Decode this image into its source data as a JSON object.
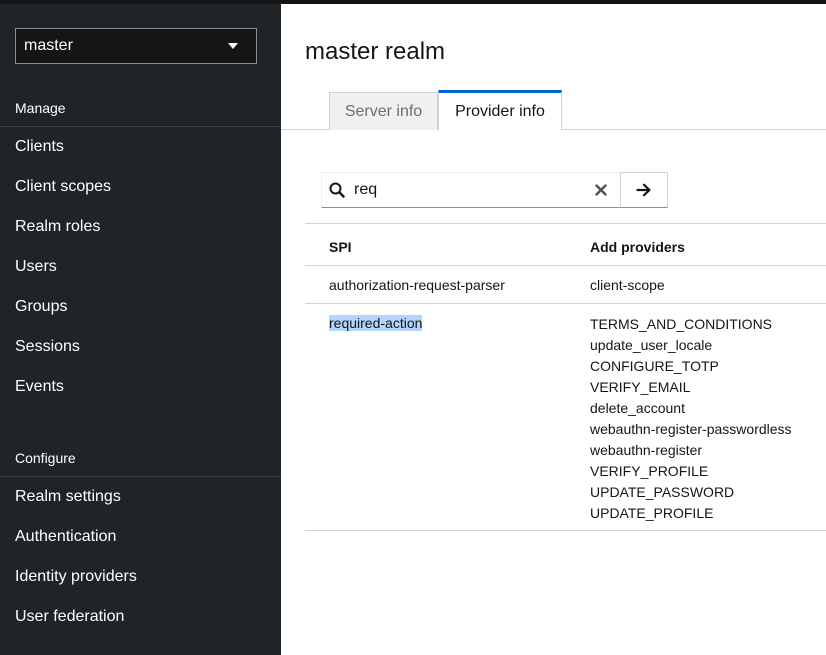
{
  "sidebar": {
    "realm_select": "master",
    "manage_title": "Manage",
    "manage_items": [
      "Clients",
      "Client scopes",
      "Realm roles",
      "Users",
      "Groups",
      "Sessions",
      "Events"
    ],
    "configure_title": "Configure",
    "configure_items": [
      "Realm settings",
      "Authentication",
      "Identity providers",
      "User federation"
    ]
  },
  "main": {
    "title": "master realm",
    "tabs": [
      {
        "label": "Server info",
        "active": false
      },
      {
        "label": "Provider info",
        "active": true
      }
    ],
    "search": {
      "value": "req",
      "icon": "search-icon",
      "clear_icon": "close-icon",
      "go_icon": "arrow-right-icon"
    },
    "table": {
      "headers": [
        "SPI",
        "Add providers"
      ],
      "rows": [
        {
          "spi": "authorization-request-parser",
          "providers": [
            "client-scope"
          ]
        },
        {
          "spi": "required-action",
          "providers": [
            "TERMS_AND_CONDITIONS",
            "update_user_locale",
            "CONFIGURE_TOTP",
            "VERIFY_EMAIL",
            "delete_account",
            "webauthn-register-passwordless",
            "webauthn-register",
            "VERIFY_PROFILE",
            "UPDATE_PASSWORD",
            "UPDATE_PROFILE"
          ]
        }
      ]
    }
  },
  "colors": {
    "sidebar_bg": "#212427",
    "active_tab_accent": "#0066cc",
    "selection_highlight": "#b3d4fc"
  }
}
